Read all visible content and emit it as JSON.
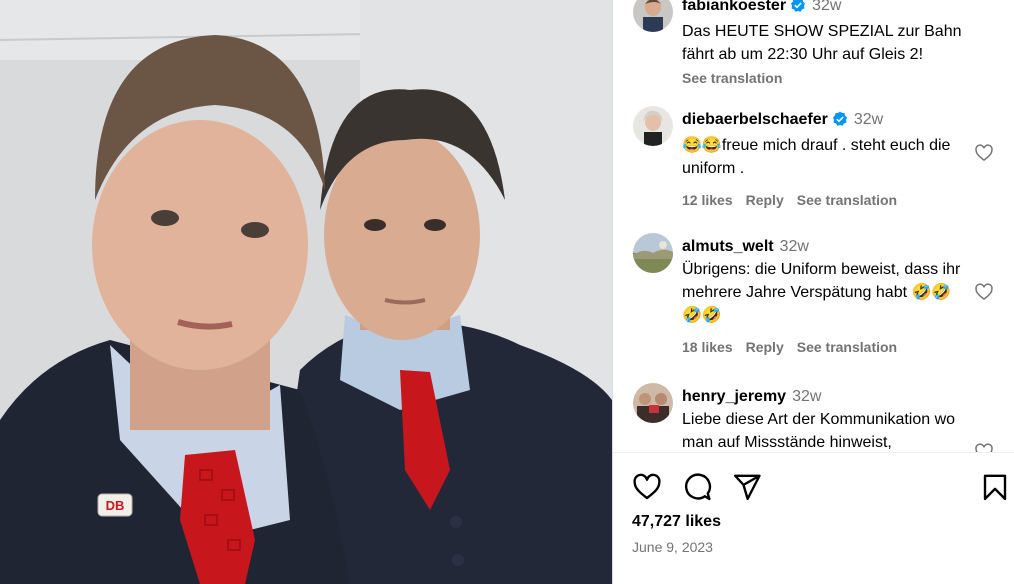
{
  "post": {
    "author": "fabiankoester",
    "author_time": "32w",
    "caption": "Das HEUTE SHOW SPEZIAL zur Bahn fährt ab um 22:30 Uhr auf Gleis 2!",
    "see_translation": "See translation",
    "photo_badge": "DB"
  },
  "comments": [
    {
      "username": "diebaerbelschaefer",
      "verified": true,
      "time": "32w",
      "text": "😂😂freue mich drauf . steht euch die uniform .",
      "likes": "12 likes",
      "reply": "Reply",
      "see_translation": "See translation"
    },
    {
      "username": "almuts_welt",
      "verified": false,
      "time": "32w",
      "text": "Übrigens: die Uniform beweist, dass ihr mehrere Jahre Verspätung habt 🤣🤣🤣🤣",
      "likes": "18 likes",
      "reply": "Reply",
      "see_translation": "See translation"
    },
    {
      "username": "henry_jeremy",
      "verified": false,
      "time": "32w",
      "text": "Liebe diese Art der Kommunikation wo man auf Missstände hinweist,"
    }
  ],
  "actions": {
    "icons": [
      "heart-icon",
      "comment-icon",
      "share-icon",
      "bookmark-icon"
    ],
    "likes_count": "47,727 likes",
    "date": "June 9, 2023"
  },
  "colors": {
    "verified_blue": "#0095f6",
    "secondary_text": "#737373",
    "tie_red": "#c8161d",
    "suit_navy": "#1f2533"
  }
}
